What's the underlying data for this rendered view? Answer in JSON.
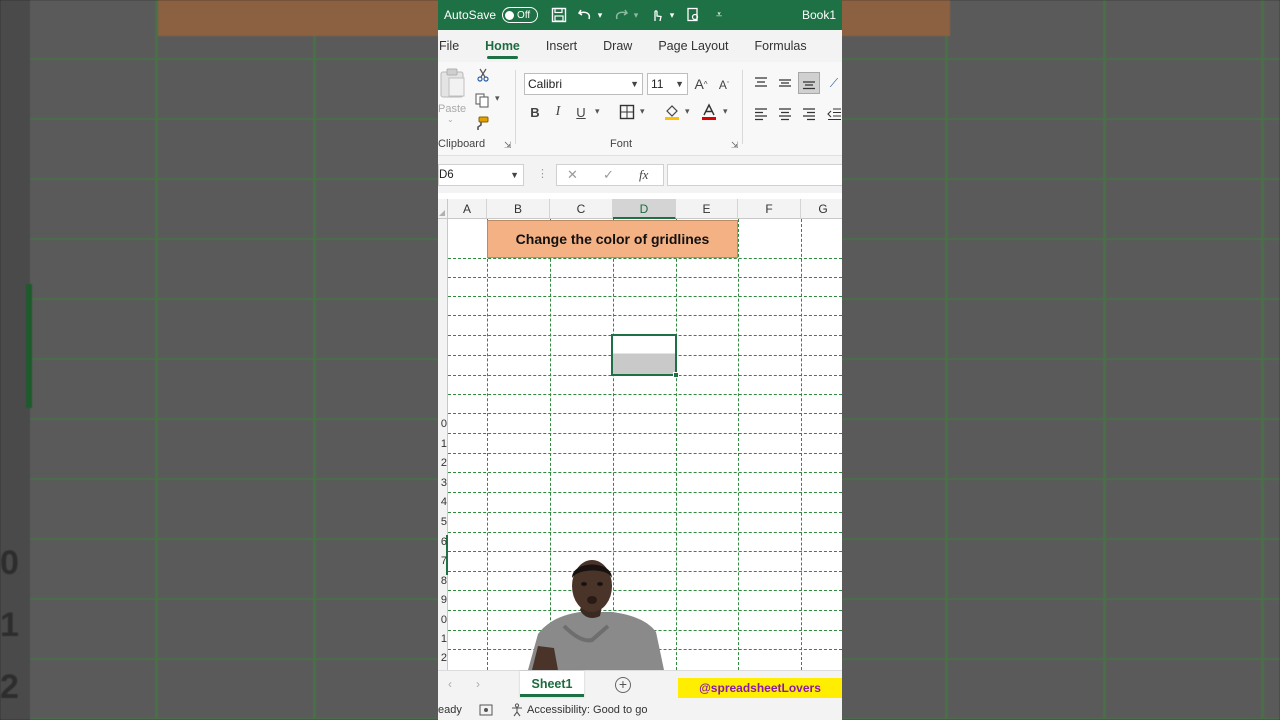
{
  "titlebar": {
    "autosave_label": "AutoSave",
    "autosave_state": "Off",
    "book_name": "Book1"
  },
  "ribbon_tabs": [
    "File",
    "Home",
    "Insert",
    "Draw",
    "Page Layout",
    "Formulas"
  ],
  "ribbon": {
    "paste_label": "Paste",
    "clipboard_label": "Clipboard",
    "font_label": "Font",
    "font_name": "Calibri",
    "font_size": "11",
    "bold": "B",
    "italic": "I",
    "underline": "U"
  },
  "formula_bar": {
    "name_box": "D6",
    "fx": "fx",
    "value": ""
  },
  "sheet": {
    "columns": [
      "A",
      "B",
      "C",
      "D",
      "E",
      "F",
      "G"
    ],
    "selected_column": "D",
    "title_cell_text": "Change the color of gridlines",
    "gridline_color": "#2f8a3f",
    "title_fill": "#f4b183",
    "row_labels": [
      "0",
      "1",
      "2",
      "3",
      "4",
      "5",
      "6",
      "7",
      "8",
      "9",
      "0",
      "1",
      "2"
    ]
  },
  "sheet_tabs": {
    "active": "Sheet1",
    "handle": "@spreadsheetLovers"
  },
  "status": {
    "ready": "eady",
    "accessibility": "Accessibility: Good to go"
  },
  "background": {
    "row_labels": [
      "0",
      "1",
      "2"
    ]
  },
  "colors": {
    "excel_green": "#1e7145",
    "handle_bg": "#ffee00",
    "handle_text": "#8b1aa8"
  }
}
